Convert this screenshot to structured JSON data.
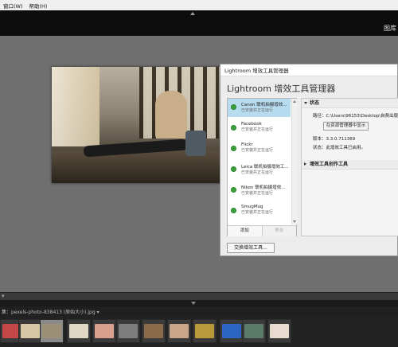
{
  "menubar": {
    "items": [
      "窗口(W)",
      "帮助(H)"
    ]
  },
  "topbar": {
    "module": "图库"
  },
  "fileinfo": {
    "text": "集：pexels-photo-838413 (原始大小).jpg ▾"
  },
  "dialog": {
    "title": "Lightroom 增效工具管理器",
    "heading": "Lightroom 增效工具管理器",
    "plugins": [
      {
        "name": "Canon 联机拍摄增效...",
        "status": "已安装并正在运行",
        "selected": true
      },
      {
        "name": "Facebook",
        "status": "已安装并正在运行",
        "selected": false
      },
      {
        "name": "Flickr",
        "status": "已安装并正在运行",
        "selected": false
      },
      {
        "name": "Leica 联机拍摄增效工...",
        "status": "已安装并正在运行",
        "selected": false
      },
      {
        "name": "Nikon 联机拍摄增效...",
        "status": "已安装并正在运行",
        "selected": false
      },
      {
        "name": "SmugMug",
        "status": "已安装并正在运行",
        "selected": false
      }
    ],
    "add_label": "添加",
    "remove_label": "移去",
    "status_section": "状态",
    "path_label": "路径：C:\\Users\\96153\\Desktop\\自费出版\\增效\\...",
    "locate_label": "在资源管理器中显示",
    "version_label": "版本：3.3.0.711369",
    "state_label": "状态：此增效工具已启用。",
    "author_section": "增效工具创作工具",
    "exchange_label": "交换增效工具..."
  },
  "colors": {
    "accent_select": "#b7dbef",
    "status_green": "#3aa23a"
  }
}
